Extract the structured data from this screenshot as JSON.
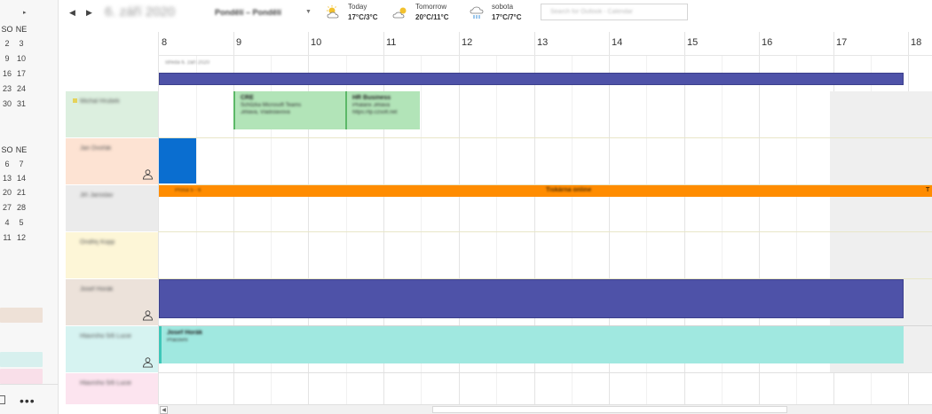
{
  "mini_calendar": {
    "arrow": "▸",
    "first_block": {
      "header": [
        "SO",
        "NE"
      ],
      "rows": [
        [
          "2",
          "3"
        ],
        [
          "9",
          "10"
        ],
        [
          "16",
          "17"
        ],
        [
          "23",
          "24"
        ],
        [
          "30",
          "31"
        ]
      ]
    },
    "second_block": {
      "header": [
        "SO",
        "NE"
      ],
      "rows": [
        [
          "6",
          "7"
        ],
        [
          "13",
          "14"
        ],
        [
          "20",
          "21"
        ],
        [
          "27",
          "28"
        ],
        [
          "4",
          "5"
        ],
        [
          "11",
          "12"
        ]
      ]
    },
    "more_label": "•••"
  },
  "header": {
    "prev_icon": "◀",
    "next_icon": "▶",
    "date_title": "6. září 2020",
    "view_dropdown": "Pondělí – Pondělí",
    "weather": [
      {
        "label": "Today",
        "temp": "17°C/3°C",
        "icon": "sun-cloud-icon"
      },
      {
        "label": "Tomorrow",
        "temp": "20°C/11°C",
        "icon": "sun-cloud-icon"
      },
      {
        "label": "sobota",
        "temp": "17°C/7°C",
        "icon": "rain-icon"
      }
    ],
    "search_placeholder": "Search for Outlook - Calendar"
  },
  "grid": {
    "hours": [
      "8",
      "9",
      "10",
      "11",
      "12",
      "13",
      "14",
      "15",
      "16",
      "17",
      "18"
    ],
    "date_caption": "středa 6. září 2020",
    "rows": [
      {
        "name": "Michal Hrubek",
        "color": "#dcefdf",
        "dot": true,
        "person_icon": false
      },
      {
        "name": "Jan Dvořák",
        "color": "#fde3d3",
        "dot": false,
        "person_icon": true
      },
      {
        "name": "Jiří Jaroslav",
        "color": "#ebebeb",
        "dot": false,
        "person_icon": false
      },
      {
        "name": "Ondřej Kopp",
        "color": "#fdf6d7",
        "dot": false,
        "person_icon": false
      },
      {
        "name": "Josef Horák",
        "color": "#ece2da",
        "dot": false,
        "person_icon": true
      },
      {
        "name": "Hlavního 5/6 Lucie",
        "color": "#d6f3f1",
        "dot": false,
        "person_icon": true
      },
      {
        "name": "Hlavního 5/6 Lucie",
        "color": "#fce4ef",
        "dot": false,
        "person_icon": false
      }
    ],
    "events": {
      "meeting_a": {
        "line1": "CRE",
        "line2": "Schůzka Microsoft Teams",
        "line3": "Jihlava, Vladislavova"
      },
      "meeting_b": {
        "line1": "HR Business",
        "line2": "Phalanx Jihlava",
        "line3": "https://tp.czsoft.net"
      },
      "orange_bar": {
        "left": "Prosa 5 - 6",
        "center": "Tiskárna online",
        "right": "T"
      },
      "teal_block": {
        "line1": "Josef Horák",
        "line2": "Pracovní"
      }
    },
    "scroll_left": "◀"
  },
  "colors": {
    "allday": "#4e52a8",
    "blue": "#0a6ed0",
    "orange": "#ff8c00",
    "green": "#b2e4b8",
    "teal": "#a0e8e0"
  }
}
